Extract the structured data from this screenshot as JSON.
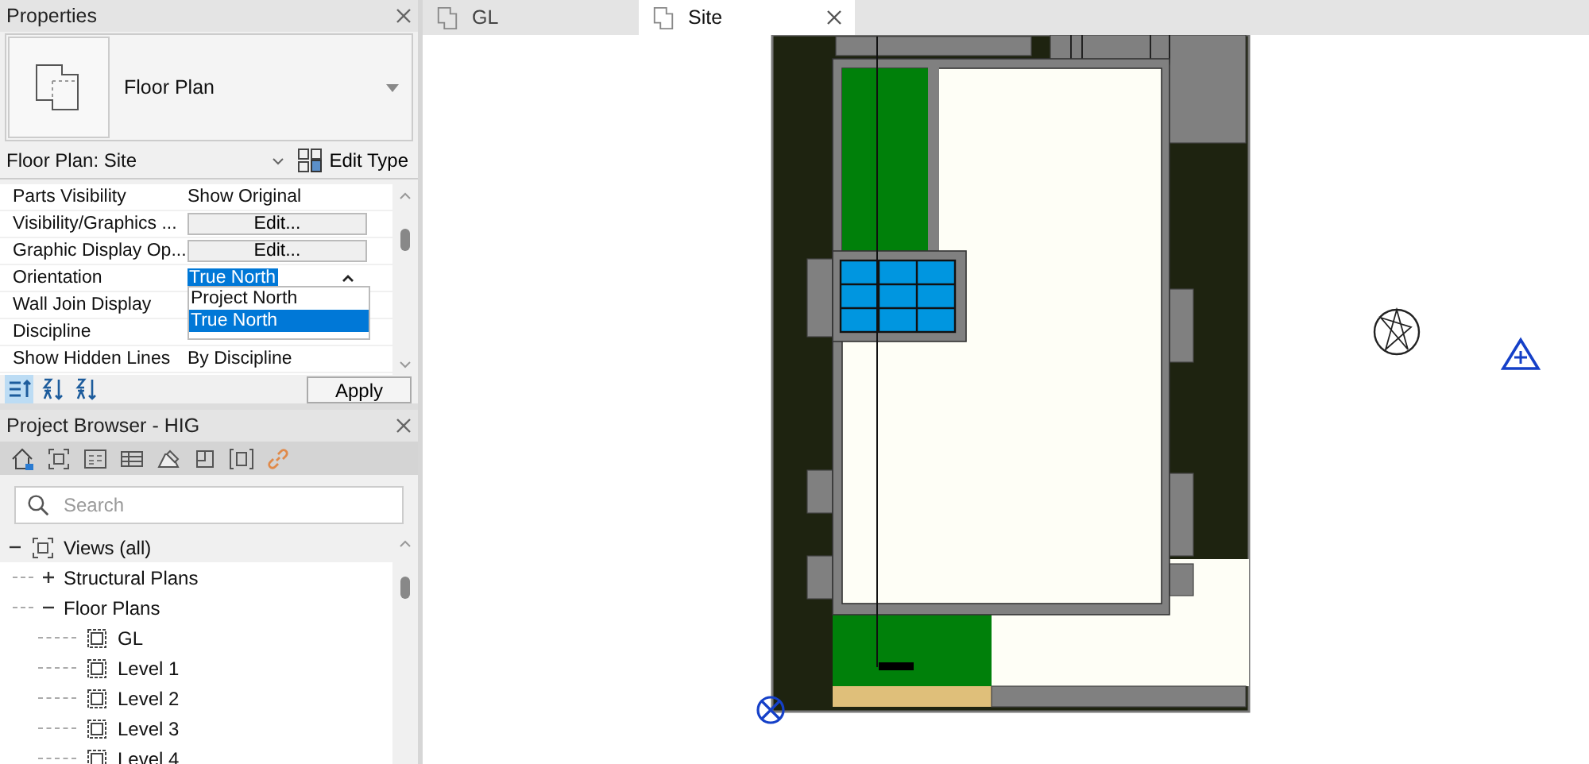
{
  "properties": {
    "title": "Properties",
    "type_name": "Floor Plan",
    "instance": "Floor Plan: Site",
    "edit_type": "Edit Type",
    "rows": [
      {
        "label": "Parts Visibility",
        "value": "Show Original",
        "kind": "text"
      },
      {
        "label": "Visibility/Graphics ...",
        "value": "Edit...",
        "kind": "button"
      },
      {
        "label": "Graphic Display Op...",
        "value": "Edit...",
        "kind": "button"
      },
      {
        "label": "Orientation",
        "value": "True North",
        "kind": "dropdown"
      },
      {
        "label": "Wall Join Display",
        "kind": "text"
      },
      {
        "label": "Discipline",
        "kind": "text"
      },
      {
        "label": "Show Hidden Lines",
        "value": "By Discipline",
        "kind": "text"
      }
    ],
    "options": [
      {
        "label": "Project North",
        "selected": false
      },
      {
        "label": "True North",
        "selected": true
      }
    ],
    "sort_tools": [
      {
        "selected": true
      },
      {
        "selected": false
      },
      {
        "selected": false
      }
    ],
    "apply": "Apply"
  },
  "browser": {
    "title": "Project Browser - HIG",
    "search_placeholder": "Search",
    "tree": [
      {
        "label": "Views (all)",
        "expanded": true,
        "children": [
          {
            "label": "Structural Plans",
            "expanded": false
          },
          {
            "label": "Floor Plans",
            "expanded": true,
            "children": [
              {
                "label": "GL"
              },
              {
                "label": "Level 1"
              },
              {
                "label": "Level 2"
              },
              {
                "label": "Level 3"
              },
              {
                "label": "Level 4"
              }
            ]
          }
        ]
      }
    ]
  },
  "tabs": [
    {
      "label": "GL",
      "selected": false
    },
    {
      "label": "Site",
      "selected": true
    }
  ]
}
